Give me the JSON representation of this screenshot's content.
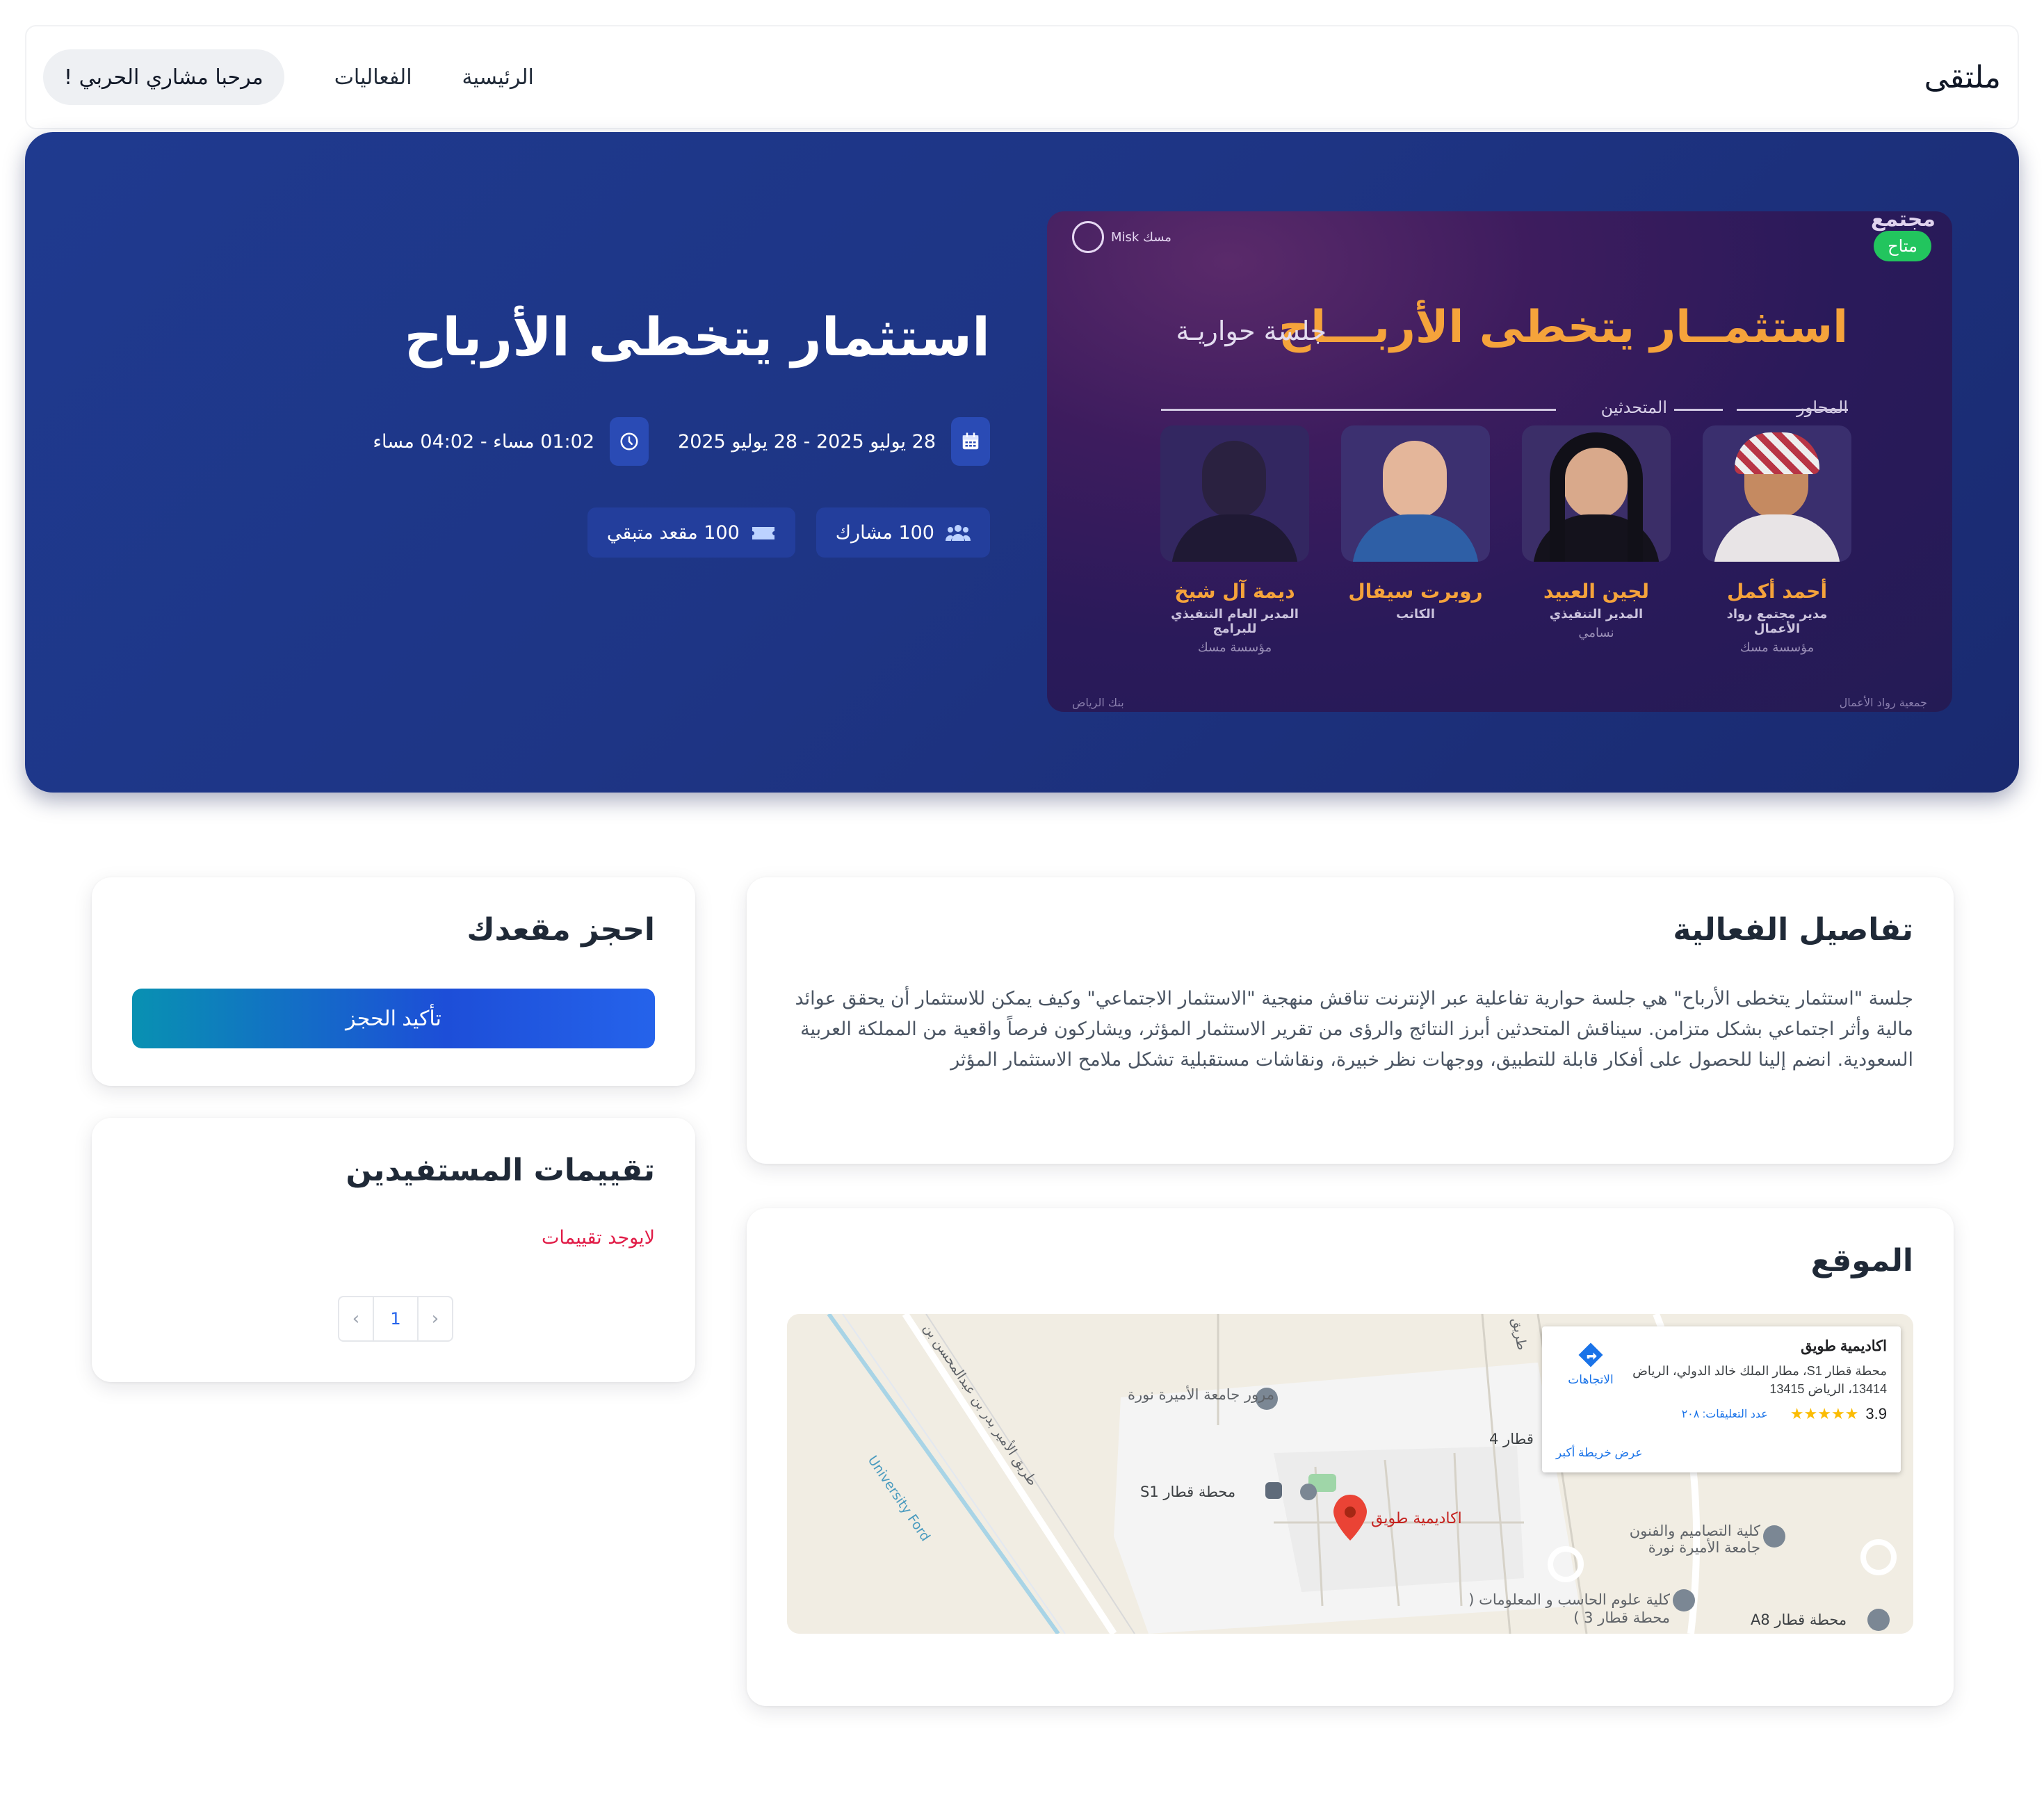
{
  "nav": {
    "brand": "ملتقى",
    "home": "الرئيسية",
    "events": "الفعاليات",
    "welcome": "مرحبا مشاري الحربي !"
  },
  "hero": {
    "title": "استثمار يتخطى الأرباح",
    "date_range": "28 يوليو 2025 - 28 يوليو 2025",
    "time_range": "01:02 مساء - 04:02 مساء",
    "participants": "100 مشارك",
    "seats_left": "100 مقعد متبقي",
    "colors": {
      "hero_bg": "#1e3585",
      "chip_bg": "#233e9c",
      "icon_box": "#2a4bb5"
    }
  },
  "poster": {
    "badge": "متاح",
    "corner_text": "مجتمع",
    "logo_text": "Misk مسك",
    "title": "استثمــار يتخطى الأربـــاح",
    "subtitle": "جلسة حواريـة",
    "moderator_heading": "المحاور",
    "speakers_heading": "المتحدثين",
    "footer_left": "بنك الرياض",
    "footer_right": "جمعية رواد الأعمال",
    "speakers": [
      {
        "name": "أحمد أكمل",
        "role": "مدير مجتمع رواد الأعمال",
        "org": "مؤسسة مسك"
      },
      {
        "name": "لجين العبيد",
        "role": "المدير التنفيذي",
        "org": "نسامي"
      },
      {
        "name": "روبرت سيفال",
        "role": "الكاتب",
        "org": ""
      },
      {
        "name": "ديمة آل شيخ",
        "role": "المدير العام التنفيذي للبرامج",
        "org": "مؤسسة مسك"
      }
    ]
  },
  "details": {
    "heading": "تفاصيل الفعالية",
    "body": "جلسة \"استثمار يتخطى الأرباح\" هي جلسة حوارية تفاعلية عبر الإنترنت تناقش منهجية \"الاستثمار الاجتماعي\" وكيف يمكن للاستثمار أن يحقق عوائد مالية وأثر اجتماعي بشكل متزامن. سيناقش المتحدثين أبرز النتائج والرؤى من تقرير الاستثمار المؤثر، ويشاركون فرصاً واقعية من المملكة العربية السعودية. انضم إلينا للحصول على أفكار قابلة للتطبيق، ووجهات نظر خبيرة، ونقاشات مستقبلية تشكل ملامح الاستثمار المؤثر"
  },
  "location": {
    "heading": "الموقع",
    "map": {
      "place_name": "اكاديمية طويق",
      "address": "محطة قطار S1، مطار الملك خالد الدولي، الرياض 13414، الرياض 13415",
      "rating": "3.9",
      "stars": "★★★★★",
      "reviews_count": "عدد التعليقات: ٢٠٨",
      "larger_map": "عرض خريطة أكبر",
      "directions": "الاتجاهات",
      "labels": {
        "traffic": "مرور جامعة الأميرة نورة",
        "station_s1": "محطة قطار S1",
        "pin": "اكاديمية طويق",
        "college_design": "كلية التصاميم والفنون جامعة الأميرة نورة",
        "college_cs": "كلية علوم الحاسب و المعلومات ( محطة قطار 3 )",
        "station_a8": "محطة قطار A8",
        "station_4": "قطار 4",
        "road_uf": "University Ford",
        "road_amir": "طريق الأمير بدر بن عبدالمحسن بن",
        "road_top": "طريق"
      }
    }
  },
  "booking": {
    "heading": "احجز مقعدك",
    "confirm": "تأكيد الحجز"
  },
  "reviews": {
    "heading": "تقييمات المستفيدين",
    "empty": "لايوجد تقييمات",
    "page": "1",
    "prev": "‹",
    "next": "›"
  }
}
